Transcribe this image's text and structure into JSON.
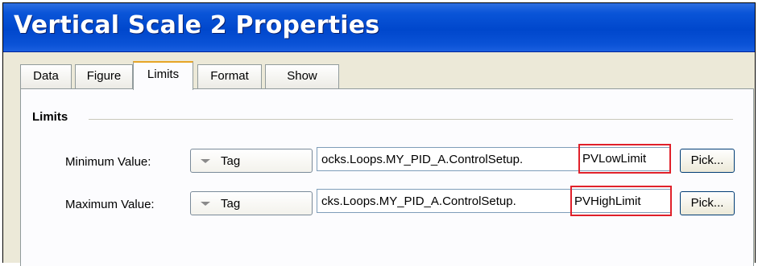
{
  "window": {
    "title": "Vertical Scale 2 Properties"
  },
  "tabs": [
    {
      "label": "Data",
      "active": false
    },
    {
      "label": "Figure",
      "active": false
    },
    {
      "label": "Limits",
      "active": true
    },
    {
      "label": "Format",
      "active": false
    },
    {
      "label": "Show",
      "active": false
    }
  ],
  "limits_group": {
    "label": "Limits",
    "rows": [
      {
        "label": "Minimum Value:",
        "source_type": "Tag",
        "tag_path": "ocks.Loops.MY_PID_A.ControlSetup.",
        "highlighted_member": "PVLowLimit",
        "pick_label": "Pick..."
      },
      {
        "label": "Maximum Value:",
        "source_type": "Tag",
        "tag_path": "cks.Loops.MY_PID_A.ControlSetup.",
        "highlighted_member": "PVHighLimit",
        "pick_label": "Pick..."
      }
    ]
  },
  "colors": {
    "titlebar": "#0047cc",
    "highlight_box": "#e0202a",
    "active_tab_accent": "#e6a526"
  }
}
